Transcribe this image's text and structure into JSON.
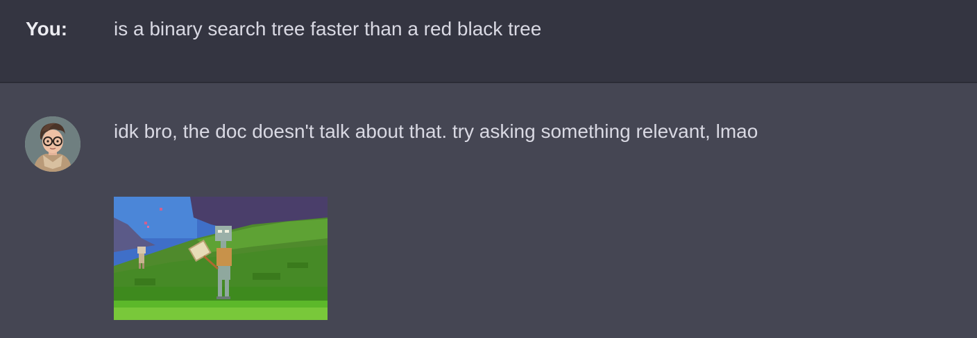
{
  "user_message": {
    "label": "You:",
    "text": "is a binary search tree faster than a red black tree"
  },
  "assistant_message": {
    "avatar_icon": "user-avatar-icon",
    "text": "idk bro, the doc doesn't talk about that. try asking something relevant, lmao",
    "attachment": "minecraft-style-gif"
  },
  "colors": {
    "user_row_bg": "#343541",
    "assistant_row_bg": "#454653",
    "text": "#d9d9e3"
  }
}
